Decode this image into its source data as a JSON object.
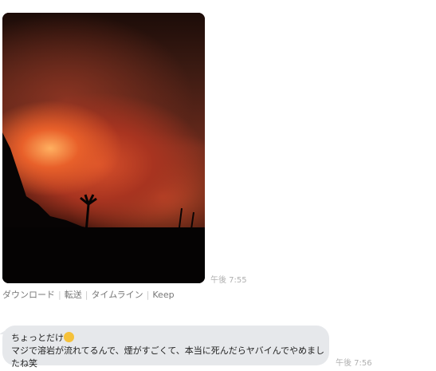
{
  "messages": [
    {
      "type": "image",
      "time": "午後 7:55",
      "actions": [
        "ダウンロード",
        "転送",
        "タイムライン",
        "Keep"
      ]
    },
    {
      "type": "text",
      "line1": "ちょっとだけ",
      "emoji": "sweat-smile-emoji",
      "line2": "マジで溶岩が流れてるんで、煙がすごくて、本当に死んだらヤバイんでやめましたね笑",
      "time": "午後 7:56"
    }
  ]
}
